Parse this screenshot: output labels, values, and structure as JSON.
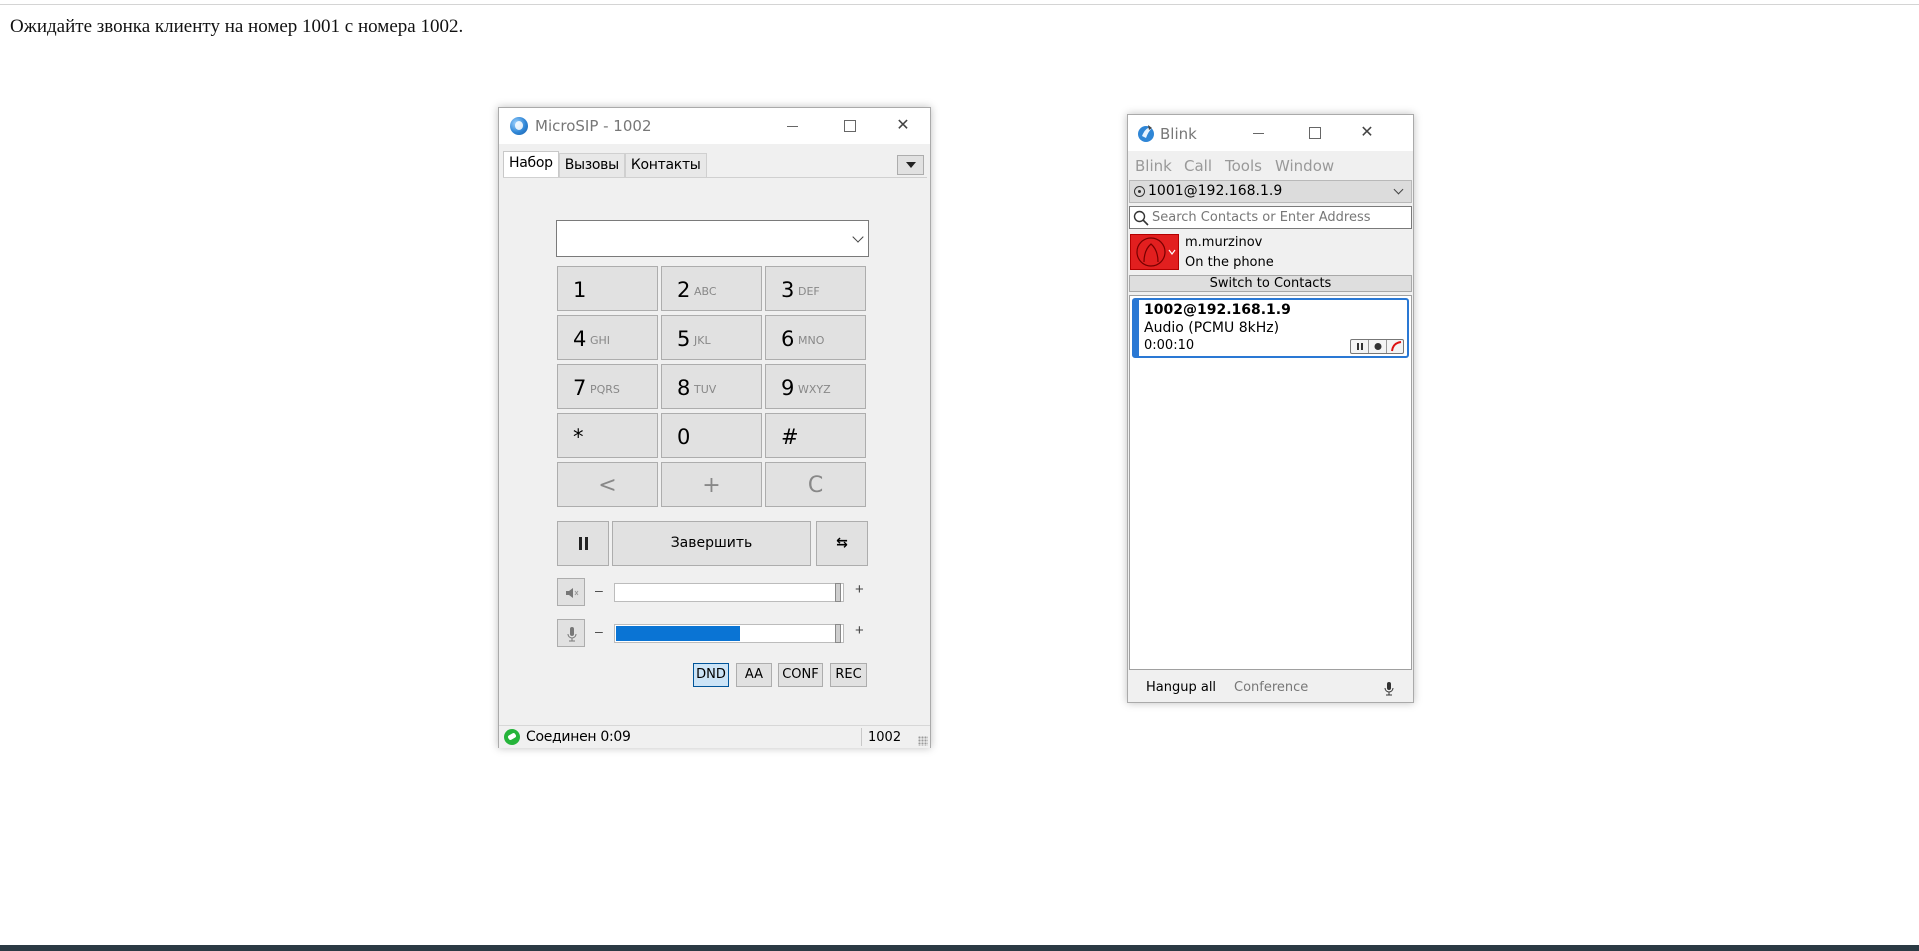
{
  "instruction": "Ожидайте звонка клиенту на номер 1001 с номера 1002.",
  "microsip": {
    "title": "MicroSIP - 1002",
    "tabs": [
      "Набор",
      "Вызовы",
      "Контакты"
    ],
    "dial_value": "",
    "keys": [
      {
        "digit": "1",
        "letters": ""
      },
      {
        "digit": "2",
        "letters": "ABC"
      },
      {
        "digit": "3",
        "letters": "DEF"
      },
      {
        "digit": "4",
        "letters": "GHI"
      },
      {
        "digit": "5",
        "letters": "JKL"
      },
      {
        "digit": "6",
        "letters": "MNO"
      },
      {
        "digit": "7",
        "letters": "PQRS"
      },
      {
        "digit": "8",
        "letters": "TUV"
      },
      {
        "digit": "9",
        "letters": "WXYZ"
      },
      {
        "digit": "*",
        "letters": ""
      },
      {
        "digit": "0",
        "letters": ""
      },
      {
        "digit": "#",
        "letters": ""
      },
      {
        "digit": "<",
        "letters": ""
      },
      {
        "digit": "+",
        "letters": ""
      },
      {
        "digit": "C",
        "letters": ""
      }
    ],
    "hangup_label": "Завершить",
    "transfer_label": "⇆",
    "slider_minus": "–",
    "slider_plus": "+",
    "speaker_level": 0.0,
    "mic_level": 0.55,
    "flags": [
      "DND",
      "AA",
      "CONF",
      "REC"
    ],
    "active_flag": "DND",
    "status_text": "Соединен 0:09",
    "status_ext": "1002"
  },
  "blink": {
    "title": "Blink",
    "menu": [
      "Blink",
      "Call",
      "Tools",
      "Window"
    ],
    "account": "1001@192.168.1.9",
    "search_placeholder": "Search Contacts or Enter Address",
    "user_name": "m.murzinov",
    "user_state": "On the phone",
    "switch_label": "Switch to Contacts",
    "session": {
      "address": "1002@192.168.1.9",
      "codec": "Audio (PCMU 8kHz)",
      "duration": "0:00:10"
    },
    "footer": {
      "hangup_all": "Hangup all",
      "conference": "Conference"
    },
    "colors": {
      "accent": "#2a78d4",
      "avatar": "#e21f1f"
    }
  }
}
